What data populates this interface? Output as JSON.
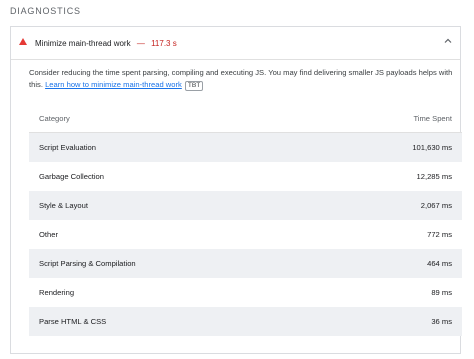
{
  "section": {
    "title": "DIAGNOSTICS"
  },
  "audit": {
    "title": "Minimize main-thread work",
    "separator": "—",
    "value": "117.3 s",
    "description": "Consider reducing the time spent parsing, compiling and executing JS. You may find delivering smaller JS payloads helps with this.",
    "learn_more": "Learn how to minimize main-thread work",
    "badge": "TBT",
    "icon": "warning-triangle-icon",
    "colors": {
      "fail": "#e53935",
      "link": "#1a73e8"
    }
  },
  "table": {
    "headers": {
      "category": "Category",
      "time": "Time Spent"
    },
    "rows": [
      {
        "category": "Script Evaluation",
        "time": "101,630 ms"
      },
      {
        "category": "Garbage Collection",
        "time": "12,285 ms"
      },
      {
        "category": "Style & Layout",
        "time": "2,067 ms"
      },
      {
        "category": "Other",
        "time": "772 ms"
      },
      {
        "category": "Script Parsing & Compilation",
        "time": "464 ms"
      },
      {
        "category": "Rendering",
        "time": "89 ms"
      },
      {
        "category": "Parse HTML & CSS",
        "time": "36 ms"
      }
    ]
  }
}
